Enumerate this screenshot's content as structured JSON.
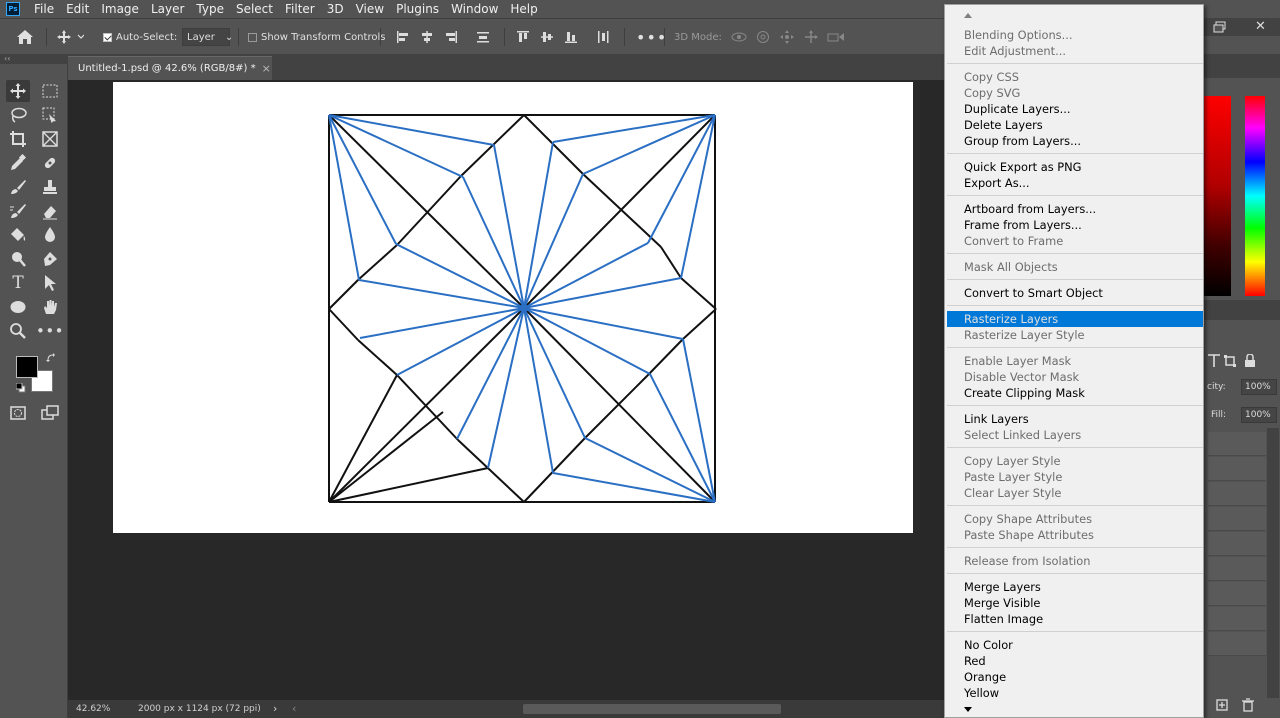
{
  "app": {
    "logo_text": "Ps",
    "menu": [
      "File",
      "Edit",
      "Image",
      "Layer",
      "Type",
      "Select",
      "Filter",
      "3D",
      "View",
      "Plugins",
      "Window",
      "Help"
    ]
  },
  "options": {
    "auto_select_label": "Auto-Select:",
    "auto_select_checked": true,
    "target_select": "Layer",
    "show_transform_label": "Show Transform Controls",
    "show_transform_checked": false,
    "mode_3d_label": "3D Mode:",
    "more_icon": "ellipsis-icon"
  },
  "document": {
    "tab_title": "Untitled-1.psd @ 42.6% (RGB/8#) *",
    "close_glyph": "×",
    "panel_collapse": "‹‹"
  },
  "status": {
    "zoom": "42.62%",
    "doc_size": "2000 px x 1124 px (72 ppi)",
    "arrow_right": "›",
    "arrow_left": "‹"
  },
  "layers_panel": {
    "opacity_label": "city:",
    "opacity_value": "100%",
    "fill_label": "Fill:",
    "fill_value": "100%"
  },
  "context_menu": {
    "sections": [
      [
        {
          "label": "Blending Options...",
          "enabled": false
        },
        {
          "label": "Edit Adjustment...",
          "enabled": false
        }
      ],
      [
        {
          "label": "Copy CSS",
          "enabled": false
        },
        {
          "label": "Copy SVG",
          "enabled": false
        },
        {
          "label": "Duplicate Layers...",
          "enabled": true
        },
        {
          "label": "Delete Layers",
          "enabled": true
        },
        {
          "label": "Group from Layers...",
          "enabled": true
        }
      ],
      [
        {
          "label": "Quick Export as PNG",
          "enabled": true
        },
        {
          "label": "Export As...",
          "enabled": true
        }
      ],
      [
        {
          "label": "Artboard from Layers...",
          "enabled": true
        },
        {
          "label": "Frame from Layers...",
          "enabled": true
        },
        {
          "label": "Convert to Frame",
          "enabled": false
        }
      ],
      [
        {
          "label": "Mask All Objects",
          "enabled": false
        }
      ],
      [
        {
          "label": "Convert to Smart Object",
          "enabled": true
        }
      ],
      [
        {
          "label": "Rasterize Layers",
          "enabled": true,
          "highlighted": true
        },
        {
          "label": "Rasterize Layer Style",
          "enabled": false
        }
      ],
      [
        {
          "label": "Enable Layer Mask",
          "enabled": false
        },
        {
          "label": "Disable Vector Mask",
          "enabled": false
        },
        {
          "label": "Create Clipping Mask",
          "enabled": true
        }
      ],
      [
        {
          "label": "Link Layers",
          "enabled": true
        },
        {
          "label": "Select Linked Layers",
          "enabled": false
        }
      ],
      [
        {
          "label": "Copy Layer Style",
          "enabled": false
        },
        {
          "label": "Paste Layer Style",
          "enabled": false
        },
        {
          "label": "Clear Layer Style",
          "enabled": false
        }
      ],
      [
        {
          "label": "Copy Shape Attributes",
          "enabled": false
        },
        {
          "label": "Paste Shape Attributes",
          "enabled": false
        }
      ],
      [
        {
          "label": "Release from Isolation",
          "enabled": false
        }
      ],
      [
        {
          "label": "Merge Layers",
          "enabled": true
        },
        {
          "label": "Merge Visible",
          "enabled": true
        },
        {
          "label": "Flatten Image",
          "enabled": true
        }
      ],
      [
        {
          "label": "No Color",
          "enabled": true
        },
        {
          "label": "Red",
          "enabled": true
        },
        {
          "label": "Orange",
          "enabled": true
        },
        {
          "label": "Yellow",
          "enabled": true
        }
      ]
    ],
    "scroll_up_icon": "triangle-up-icon",
    "scroll_down_icon": "triangle-down-icon"
  },
  "colors": {
    "accent": "#0078d7",
    "shape_stroke_blue": "#2a6fc4",
    "shape_stroke_black": "#111111",
    "foreground": "#000000",
    "background": "#ffffff"
  }
}
